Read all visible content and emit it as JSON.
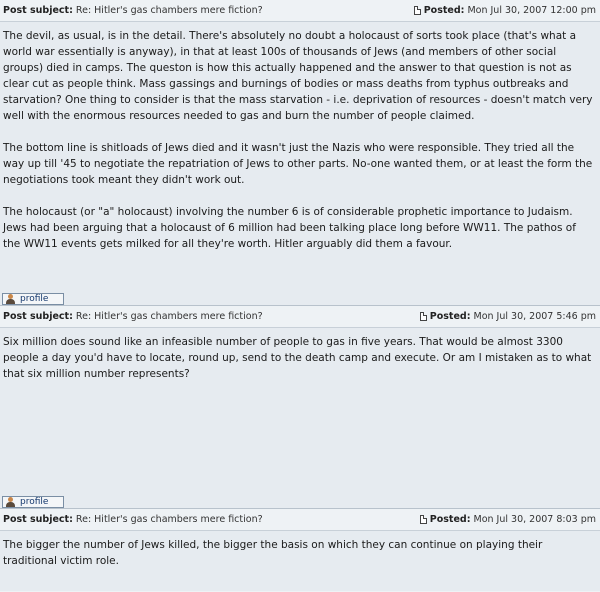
{
  "posts": [
    {
      "subject_label": "Post subject:",
      "subject": "Re: Hitler's gas chambers mere fiction?",
      "posted_label": "Posted:",
      "posted_date": "Mon Jul 30, 2007 12:00 pm",
      "paragraphs": [
        "The devil, as usual, is in the detail. There's absolutely no doubt a holocaust of sorts took place (that's what a world war essentially is anyway), in that at least 100s of thousands of Jews (and members of other social groups) died in camps. The queston is how this actually happened and the answer to that question is not as clear cut as people think. Mass gassings and burnings of bodies or mass deaths from typhus outbreaks and starvation? One thing to consider is that the mass starvation - i.e. deprivation of resources - doesn't match very well with the enormous resources needed to gas and burn the number of people claimed.",
        "The bottom line is shitloads of Jews died and it wasn't just the Nazis who were responsible. They tried all the way up till '45 to negotiate the repatriation of Jews to other parts. No-one wanted them, or at least the form the negotiations took meant they didn't work out.",
        "The holocaust (or \"a\" holocaust) involving the number 6 is of considerable prophetic importance to Judaism. Jews had been arguing that a holocaust of 6 million had been talking place long before WW11. The pathos of the WW11 events gets milked for all they're worth. Hitler arguably did them a favour."
      ],
      "profile_label": "profile"
    },
    {
      "subject_label": "Post subject:",
      "subject": "Re: Hitler's gas chambers mere fiction?",
      "posted_label": "Posted:",
      "posted_date": "Mon Jul 30, 2007 5:46 pm",
      "paragraphs": [
        "Six million does sound like an infeasible number of people to gas in five years. That would be almost 3300 people a day you'd have to locate, round up, send to the death camp and execute. Or am I mistaken as to what that six million number represents?"
      ],
      "profile_label": "profile"
    },
    {
      "subject_label": "Post subject:",
      "subject": "Re: Hitler's gas chambers mere fiction?",
      "posted_label": "Posted:",
      "posted_date": "Mon Jul 30, 2007 8:03 pm",
      "paragraphs": [
        "The bigger the number of Jews killed, the bigger the basis on which they can continue on playing their traditional victim role."
      ]
    }
  ]
}
